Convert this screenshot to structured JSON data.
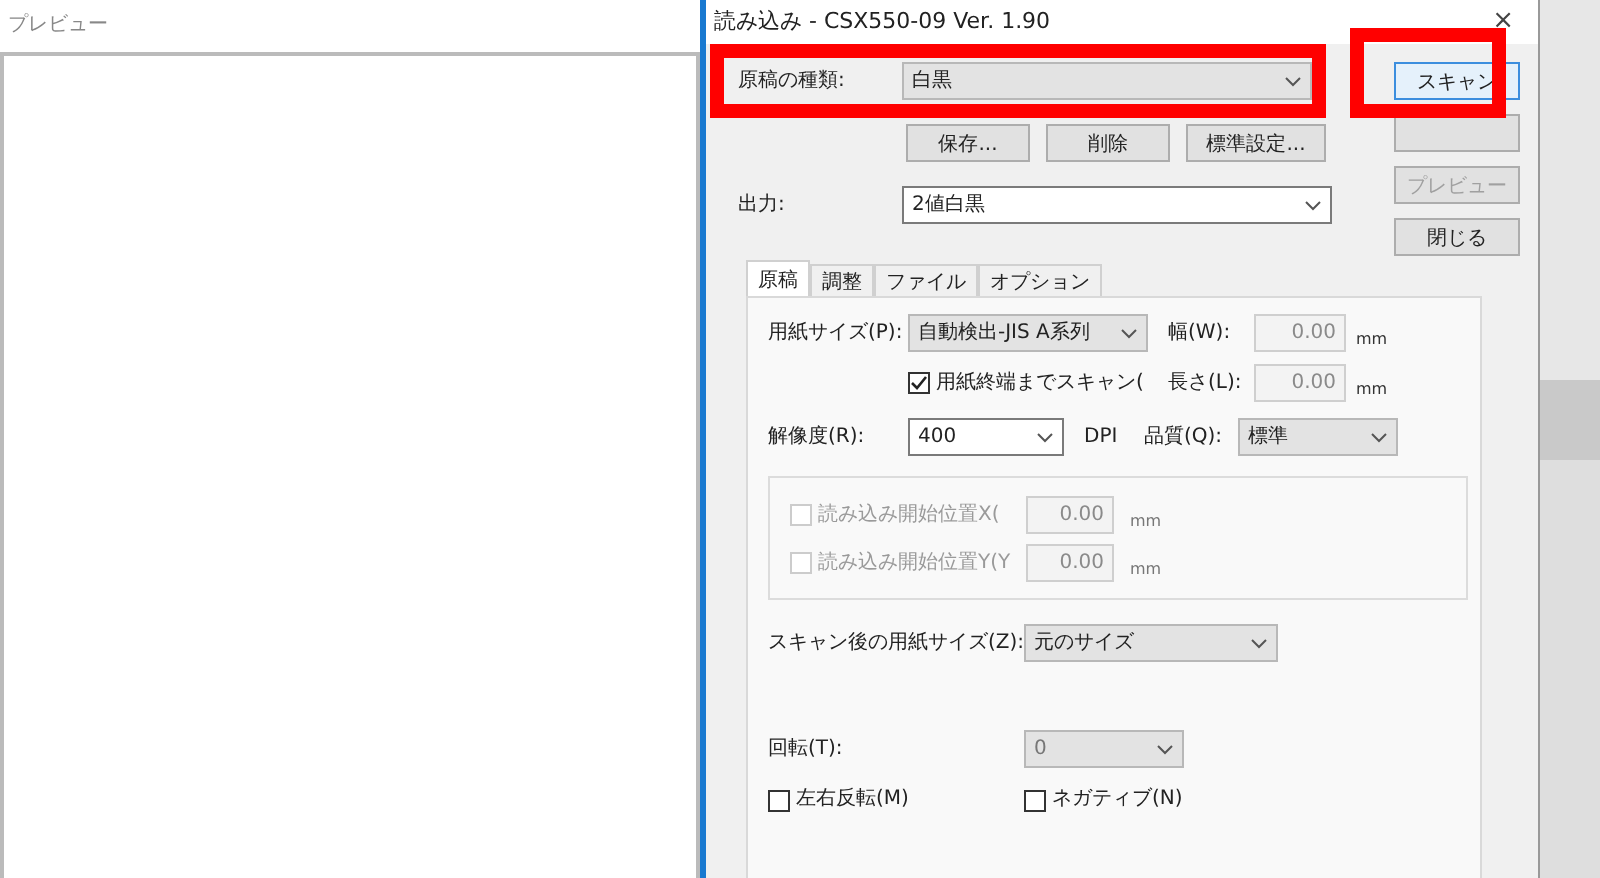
{
  "preview_window": {
    "title": "プレビュー"
  },
  "dialog": {
    "title": "読み込み - CSX550-09 Ver. 1.90",
    "close": "×"
  },
  "document_type": {
    "label": "原稿の種類:",
    "value": "白黒"
  },
  "preset_buttons": [
    {
      "label": "保存..."
    },
    {
      "label": "削除"
    },
    {
      "label": "標準設定..."
    }
  ],
  "side_buttons": [
    {
      "label": "スキャン",
      "disabled": false,
      "default": true
    },
    {
      "default": false
    },
    {
      "label": "プレビュー",
      "disabled": true,
      "default": false
    },
    {
      "label": "閉じる",
      "disabled": false,
      "default": false
    }
  ],
  "output": {
    "label": "出力:",
    "value": "2値白黒"
  },
  "tabs": [
    {
      "label": "原稿",
      "selected": true
    },
    {
      "label": "調整",
      "selected": false
    },
    {
      "label": "ファイル",
      "selected": false
    },
    {
      "label": "オプション",
      "selected": false
    }
  ],
  "paper_size": {
    "label": "用紙サイズ(P):",
    "value": "自動検出-JIS A系列"
  },
  "width": {
    "label": "幅(W):",
    "value": "0.00",
    "unit": "mm"
  },
  "scan_to_end": {
    "label": "用紙終端までスキャン(",
    "checked": true
  },
  "length": {
    "label": "長さ(L):",
    "value": "0.00",
    "unit": "mm"
  },
  "resolution": {
    "label": "解像度(R):",
    "value": "400",
    "unit": "DPI"
  },
  "quality": {
    "label": "品質(Q):",
    "value": "標準"
  },
  "start_positions": [
    {
      "label": "読み込み開始位置X(",
      "value": "0.00",
      "unit": "mm",
      "checked": false,
      "disabled": true
    },
    {
      "label": "読み込み開始位置Y(Y",
      "value": "0.00",
      "unit": "mm",
      "checked": false,
      "disabled": true
    }
  ],
  "output_size": {
    "label": "スキャン後の用紙サイズ(Z):",
    "value": "元のサイズ"
  },
  "rotation": {
    "label": "回転(T):",
    "value": "0"
  },
  "options": [
    {
      "label": "左右反転(M)",
      "checked": false
    },
    {
      "label": "ネガティブ(N)",
      "checked": false
    }
  ]
}
